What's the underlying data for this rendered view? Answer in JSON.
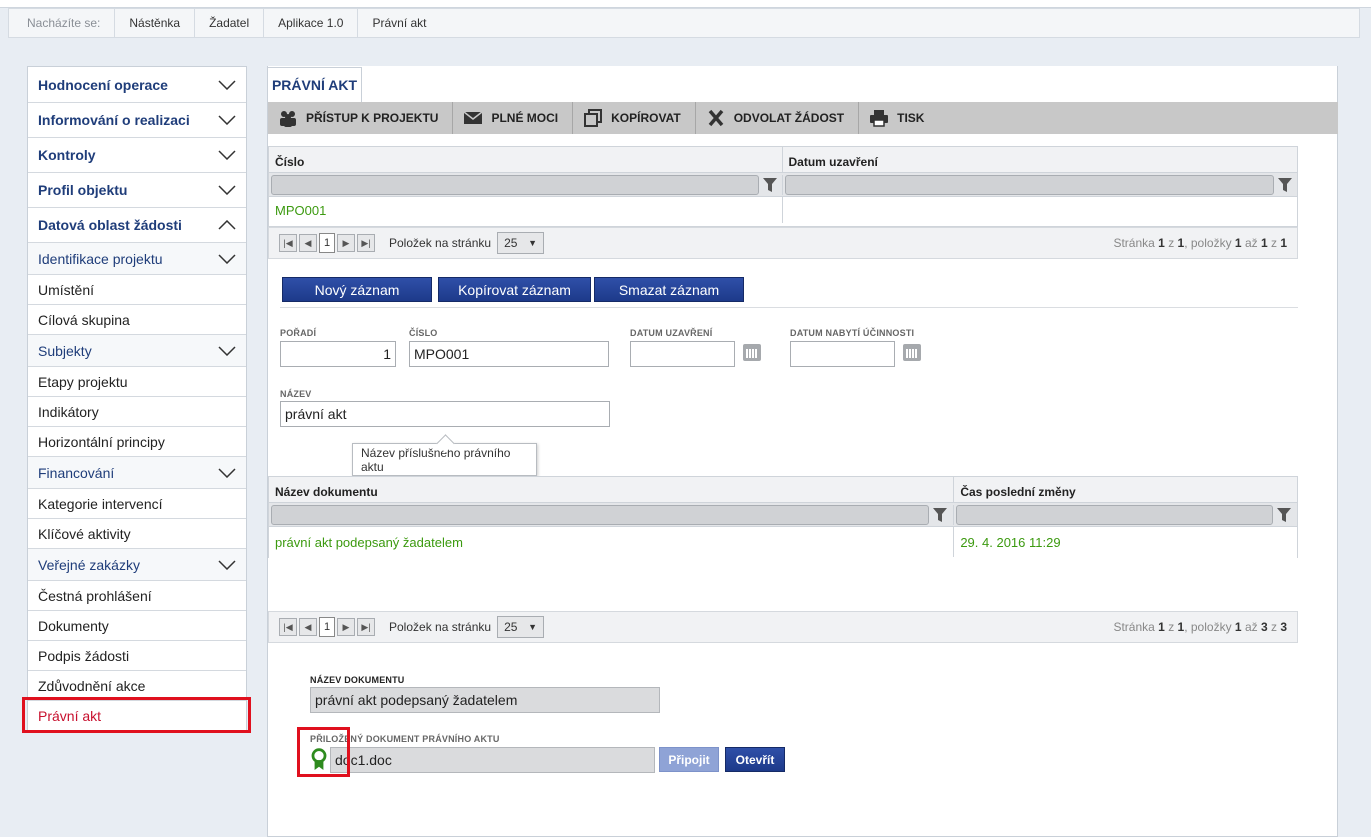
{
  "breadcrumb": {
    "lead": "Nacházíte se:",
    "items": [
      "Nástěnka",
      "Žadatel",
      "Aplikace 1.0",
      "Právní akt"
    ]
  },
  "sidebar": {
    "items": [
      {
        "label": "Hodnocení operace",
        "kind": "head",
        "chevron": "down"
      },
      {
        "label": "Informování o realizaci",
        "kind": "head",
        "chevron": "down"
      },
      {
        "label": "Kontroly",
        "kind": "head",
        "chevron": "down"
      },
      {
        "label": "Profil objektu",
        "kind": "head",
        "chevron": "down"
      },
      {
        "label": "Datová oblast žádosti",
        "kind": "head",
        "chevron": "up"
      },
      {
        "label": "Identifikace projektu",
        "kind": "sub",
        "chevron": "down"
      },
      {
        "label": "Umístění",
        "kind": "leaf"
      },
      {
        "label": "Cílová skupina",
        "kind": "leaf"
      },
      {
        "label": "Subjekty",
        "kind": "sub",
        "chevron": "down"
      },
      {
        "label": "Etapy projektu",
        "kind": "leaf"
      },
      {
        "label": "Indikátory",
        "kind": "leaf"
      },
      {
        "label": "Horizontální principy",
        "kind": "leaf"
      },
      {
        "label": "Financování",
        "kind": "sub",
        "chevron": "down"
      },
      {
        "label": "Kategorie intervencí",
        "kind": "leaf"
      },
      {
        "label": "Klíčové aktivity",
        "kind": "leaf"
      },
      {
        "label": "Veřejné zakázky",
        "kind": "sub",
        "chevron": "down"
      },
      {
        "label": "Čestná prohlášení",
        "kind": "leaf"
      },
      {
        "label": "Dokumenty",
        "kind": "leaf"
      },
      {
        "label": "Podpis žádosti",
        "kind": "leaf"
      },
      {
        "label": "Zdůvodnění akce",
        "kind": "leaf"
      },
      {
        "label": "Právní akt",
        "kind": "leaf",
        "active": true
      }
    ]
  },
  "tab": {
    "label": "PRÁVNÍ AKT"
  },
  "toolbar": {
    "access_label": "PŘÍSTUP K PROJEKTU",
    "poa_label": "PLNÉ MOCI",
    "copy_label": "KOPÍROVAT",
    "withdraw_label": "ODVOLAT ŽÁDOST",
    "print_label": "TISK"
  },
  "grid1": {
    "columns": [
      "Číslo",
      "Datum uzavření"
    ],
    "rows": [
      [
        "MPO001",
        ""
      ]
    ],
    "pager": {
      "current_page": "1",
      "per_page_label": "Položek na stránku",
      "per_page": "25",
      "info_prefix": "Stránka ",
      "page": "1",
      "of": " z ",
      "pages": "1",
      "items_label": ", položky ",
      "from": "1",
      "to_label": " až ",
      "to": "1",
      "of2": " z ",
      "total": "1"
    }
  },
  "actions": {
    "new_label": "Nový záznam",
    "copy_label": "Kopírovat záznam",
    "delete_label": "Smazat záznam"
  },
  "form": {
    "order_label": "POŘADÍ",
    "order_value": "1",
    "number_label": "ČÍSLO",
    "number_value": "MPO001",
    "closed_label": "DATUM UZAVŘENÍ",
    "closed_value": "",
    "effective_label": "DATUM NABYTÍ ÚČINNOSTI",
    "effective_value": "",
    "name_label": "NÁZEV",
    "name_value": "právní akt",
    "tooltip": "Název příslušného právního aktu"
  },
  "grid2": {
    "columns": [
      "Název dokumentu",
      "Čas poslední změny"
    ],
    "rows": [
      [
        "právní akt podepsaný žadatelem",
        "29. 4. 2016 11:29"
      ]
    ],
    "pager": {
      "current_page": "1",
      "per_page_label": "Položek na stránku",
      "per_page": "25",
      "info_prefix": "Stránka ",
      "page": "1",
      "of": " z ",
      "pages": "1",
      "items_label": ", položky ",
      "from": "1",
      "to_label": " až ",
      "to": "3",
      "of2": " z ",
      "total": "3"
    }
  },
  "doc": {
    "name_label": "NÁZEV DOKUMENTU",
    "name_value": "právní akt podepsaný žadatelem",
    "attach_label": "PŘILOŽENÝ DOKUMENT PRÁVNÍHO AKTU",
    "file_value": "doc1.doc",
    "attach_button": "Připojit",
    "open_button": "Otevřít"
  },
  "colors": {
    "accent": "#1f3d7a",
    "link_green": "#3c9a10",
    "highlight_red": "#e0101e"
  }
}
